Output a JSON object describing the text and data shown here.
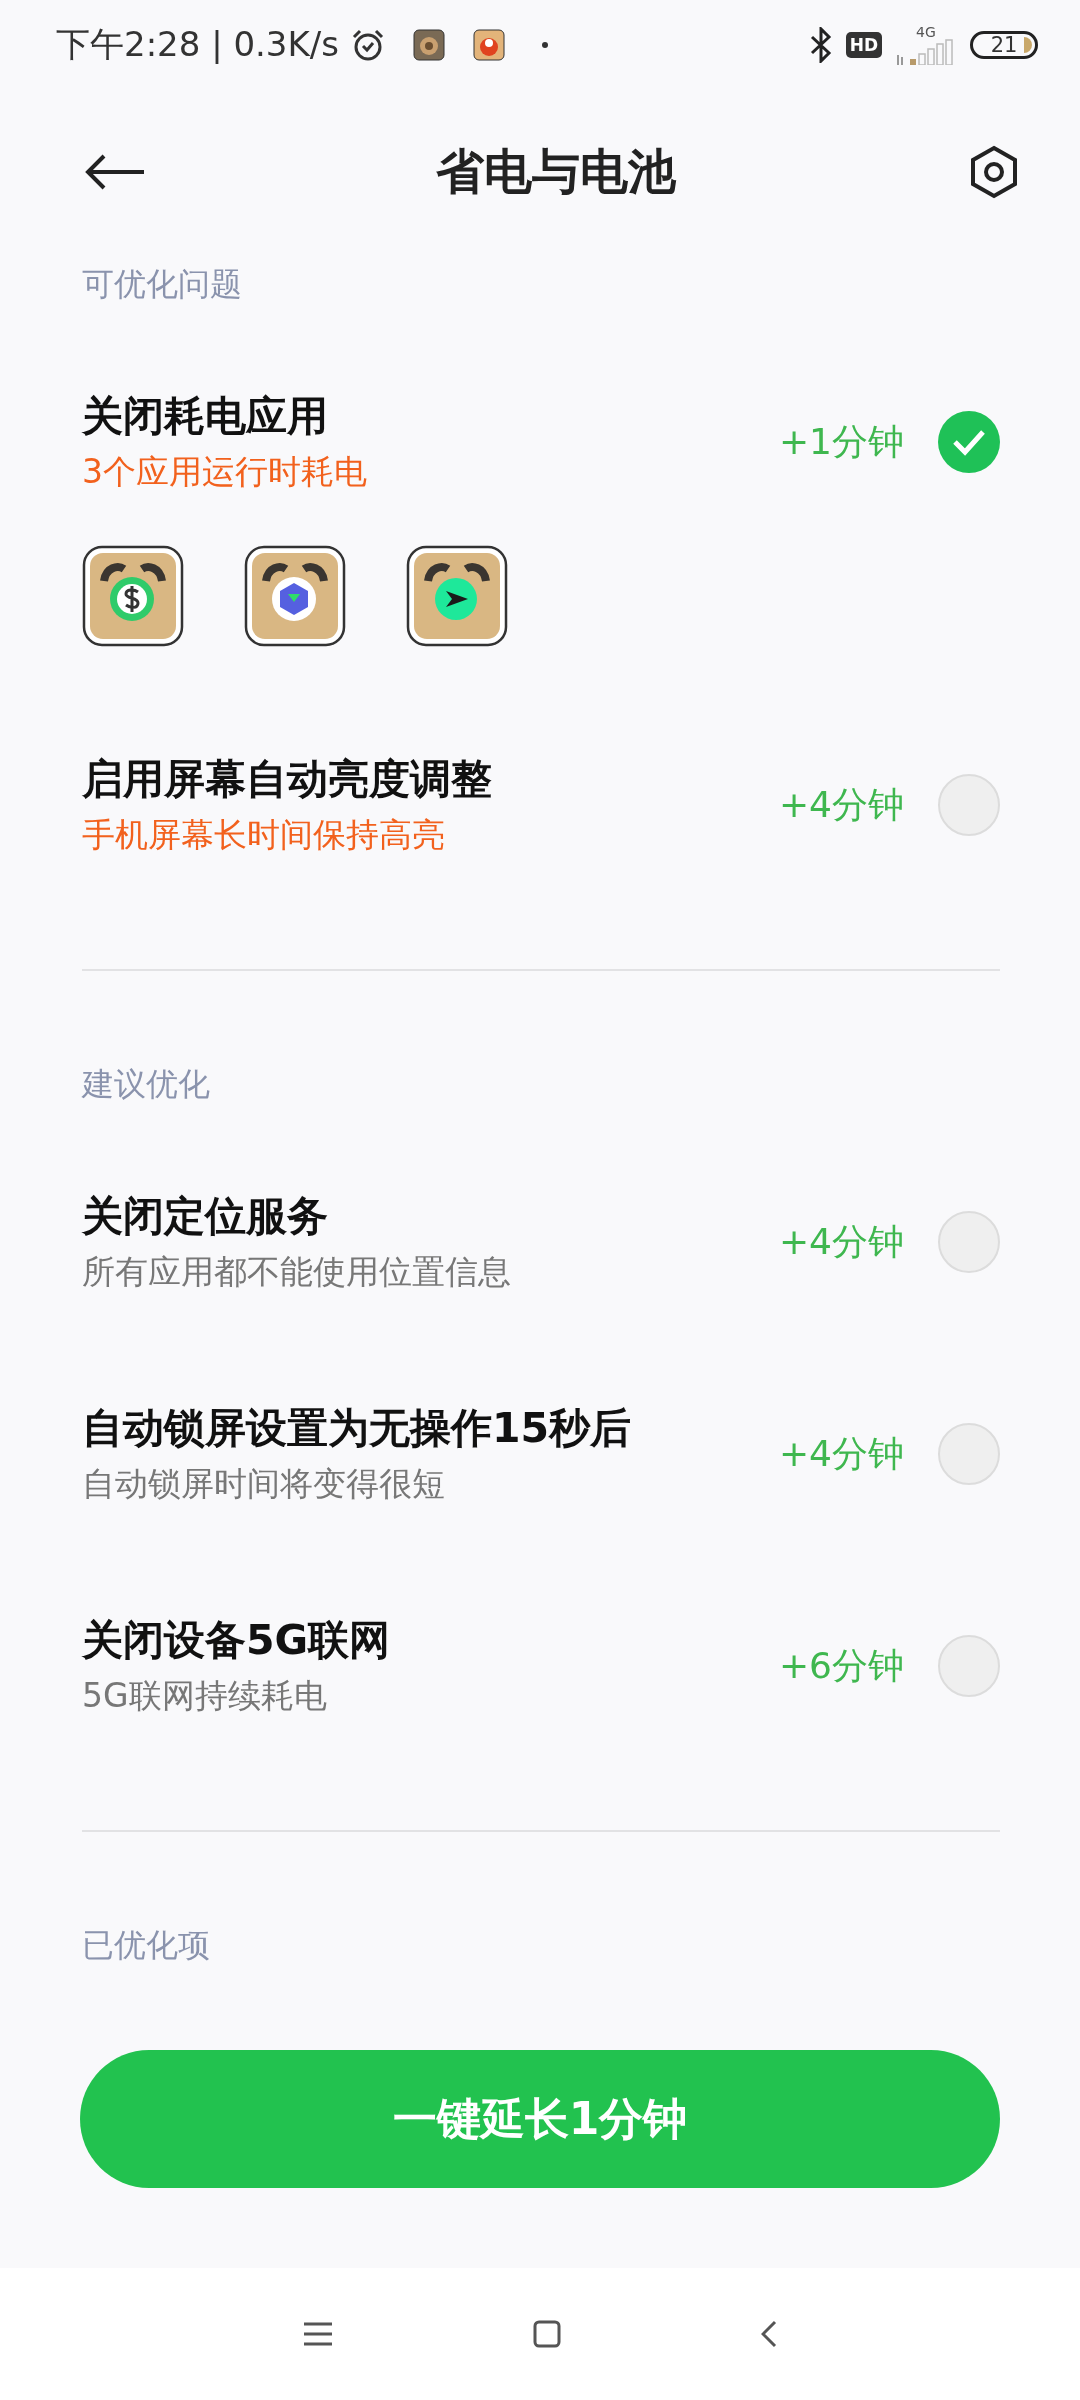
{
  "status_bar": {
    "time_speed": "下午2:28 | 0.3K/s",
    "hd": "HD",
    "network": "4G",
    "battery": "21"
  },
  "header": {
    "title": "省电与电池"
  },
  "sections": [
    {
      "label": "可优化问题",
      "items": [
        {
          "title": "关闭耗电应用",
          "subtitle": "3个应用运行时耗电",
          "warning": true,
          "gain": "+1分钟",
          "checked": true,
          "apps": [
            {
              "kind": "dollar"
            },
            {
              "kind": "cube"
            },
            {
              "kind": "send"
            }
          ]
        },
        {
          "title": "启用屏幕自动亮度调整",
          "subtitle": "手机屏幕长时间保持高亮",
          "warning": true,
          "gain": "+4分钟",
          "checked": false
        }
      ]
    },
    {
      "label": "建议优化",
      "items": [
        {
          "title": "关闭定位服务",
          "subtitle": "所有应用都不能使用位置信息",
          "warning": false,
          "gain": "+4分钟",
          "checked": false
        },
        {
          "title": "自动锁屏设置为无操作15秒后",
          "subtitle": "自动锁屏时间将变得很短",
          "warning": false,
          "gain": "+4分钟",
          "checked": false
        },
        {
          "title": "关闭设备5G联网",
          "subtitle": "5G联网持续耗电",
          "warning": false,
          "gain": "+6分钟",
          "checked": false
        }
      ]
    },
    {
      "label": "已优化项"
    }
  ],
  "action_button": {
    "label": "一键延长1分钟"
  }
}
